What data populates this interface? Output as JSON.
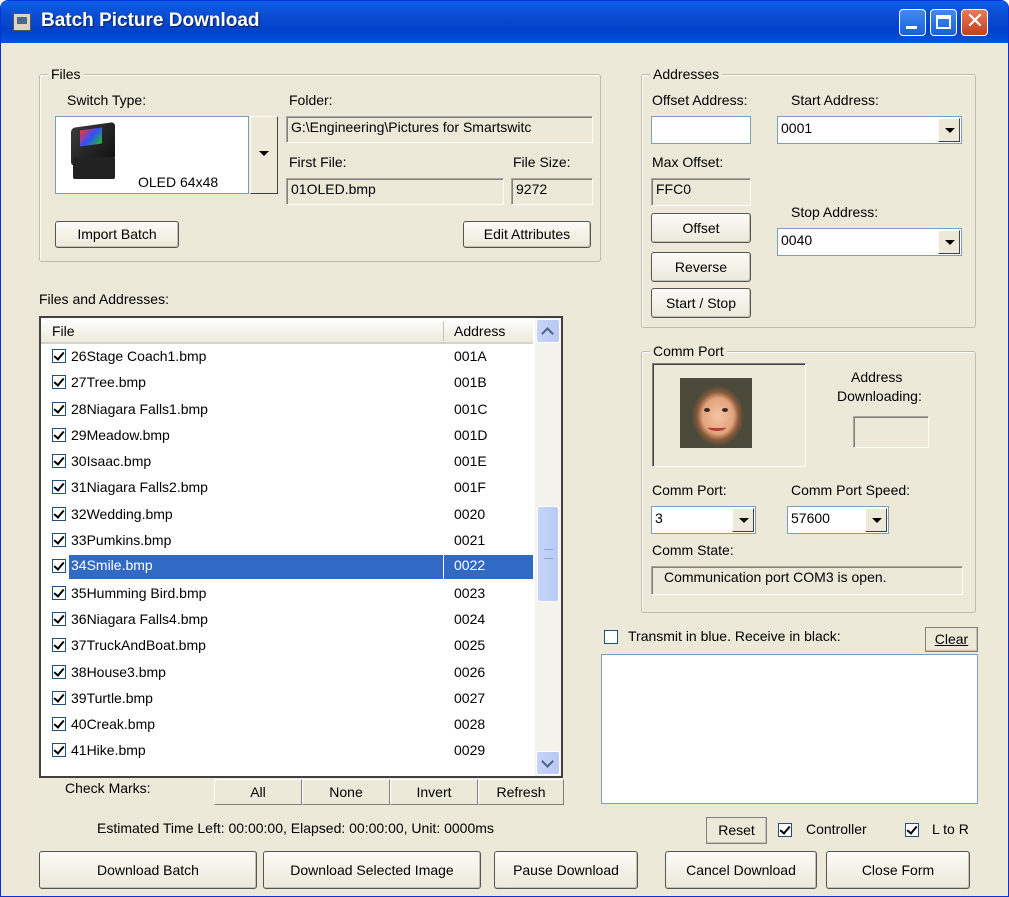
{
  "window": {
    "title": "Batch Picture Download"
  },
  "files_group": {
    "legend": "Files",
    "switch_type_label": "Switch Type:",
    "switch_type_value": "OLED 64x48",
    "folder_label": "Folder:",
    "folder_value": "G:\\Engineering\\Pictures for Smartswitc",
    "first_file_label": "First File:",
    "first_file_value": "01OLED.bmp",
    "file_size_label": "File Size:",
    "file_size_value": "9272",
    "import_batch": "Import Batch",
    "edit_attributes": "Edit Attributes"
  },
  "files_addresses_label": "Files and Addresses:",
  "list": {
    "col_file": "File",
    "col_address": "Address",
    "rows": [
      {
        "file": "26Stage Coach1.bmp",
        "address": "001A"
      },
      {
        "file": "27Tree.bmp",
        "address": "001B"
      },
      {
        "file": "28Niagara Falls1.bmp",
        "address": "001C"
      },
      {
        "file": "29Meadow.bmp",
        "address": "001D"
      },
      {
        "file": "30Isaac.bmp",
        "address": "001E"
      },
      {
        "file": "31Niagara Falls2.bmp",
        "address": "001F"
      },
      {
        "file": "32Wedding.bmp",
        "address": "0020"
      },
      {
        "file": "33Pumkins.bmp",
        "address": "0021"
      },
      {
        "file": "34Smile.bmp",
        "address": "0022"
      },
      {
        "file": "35Humming Bird.bmp",
        "address": "0023"
      },
      {
        "file": "36Niagara Falls4.bmp",
        "address": "0024"
      },
      {
        "file": "37TruckAndBoat.bmp",
        "address": "0025"
      },
      {
        "file": "38House3.bmp",
        "address": "0026"
      },
      {
        "file": "39Turtle.bmp",
        "address": "0027"
      },
      {
        "file": "40Creak.bmp",
        "address": "0028"
      },
      {
        "file": "41Hike.bmp",
        "address": "0029"
      }
    ]
  },
  "check_marks": {
    "label": "Check Marks:",
    "all": "All",
    "none": "None",
    "invert": "Invert",
    "refresh": "Refresh"
  },
  "status_text": "Estimated Time Left: 00:00:00, Elapsed: 00:00:00, Unit: 0000ms",
  "addresses_group": {
    "legend": "Addresses",
    "offset_address_label": "Offset Address:",
    "offset_address_value": "",
    "start_address_label": "Start Address:",
    "start_address_value": "0001",
    "max_offset_label": "Max Offset:",
    "max_offset_value": "FFC0",
    "stop_address_label": "Stop Address:",
    "stop_address_value": "0040",
    "offset_btn": "Offset",
    "reverse_btn": "Reverse",
    "start_stop_btn": "Start / Stop"
  },
  "comm_group": {
    "legend": "Comm Port",
    "address_downloading_label_1": "Address",
    "address_downloading_label_2": "Downloading:",
    "address_downloading_value": "",
    "comm_port_label": "Comm Port:",
    "comm_port_value": "3",
    "comm_speed_label": "Comm Port Speed:",
    "comm_speed_value": "57600",
    "comm_state_label": "Comm State:",
    "comm_state_value": "Communication port COM3 is open."
  },
  "terminal": {
    "transmit_label": "Transmit in blue. Receive in black:",
    "clear": "Clear",
    "content": ""
  },
  "options": {
    "reset": "Reset",
    "controller": "Controller",
    "l_to_r": "L to R"
  },
  "bottom_buttons": {
    "download_batch": "Download Batch",
    "download_selected": "Download Selected Image",
    "pause": "Pause  Download",
    "cancel": "Cancel Download",
    "close": "Close Form"
  }
}
